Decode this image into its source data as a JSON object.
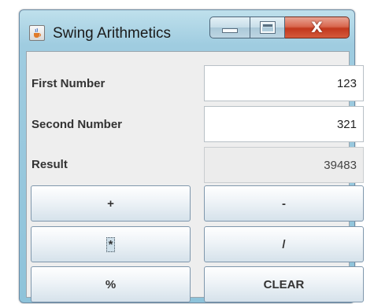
{
  "window": {
    "title": "Swing Arithmetics",
    "controls": {
      "minimize": "minimize",
      "maximize": "maximize",
      "close": "X"
    }
  },
  "form": {
    "first_number": {
      "label": "First Number",
      "value": "123"
    },
    "second_number": {
      "label": "Second Number",
      "value": "321"
    },
    "result": {
      "label": "Result",
      "value": "39483"
    }
  },
  "buttons": {
    "add": "+",
    "subtract": "-",
    "multiply": "*",
    "divide": "/",
    "modulo": "%",
    "clear": "CLEAR"
  },
  "icons": {
    "app": "java-cup-icon",
    "minimize": "minimize-icon",
    "maximize": "maximize-icon",
    "close": "close-icon"
  },
  "colors": {
    "title_bar": "#9fcce0",
    "close_button": "#c2381d",
    "content_bg": "#eeeeee"
  }
}
